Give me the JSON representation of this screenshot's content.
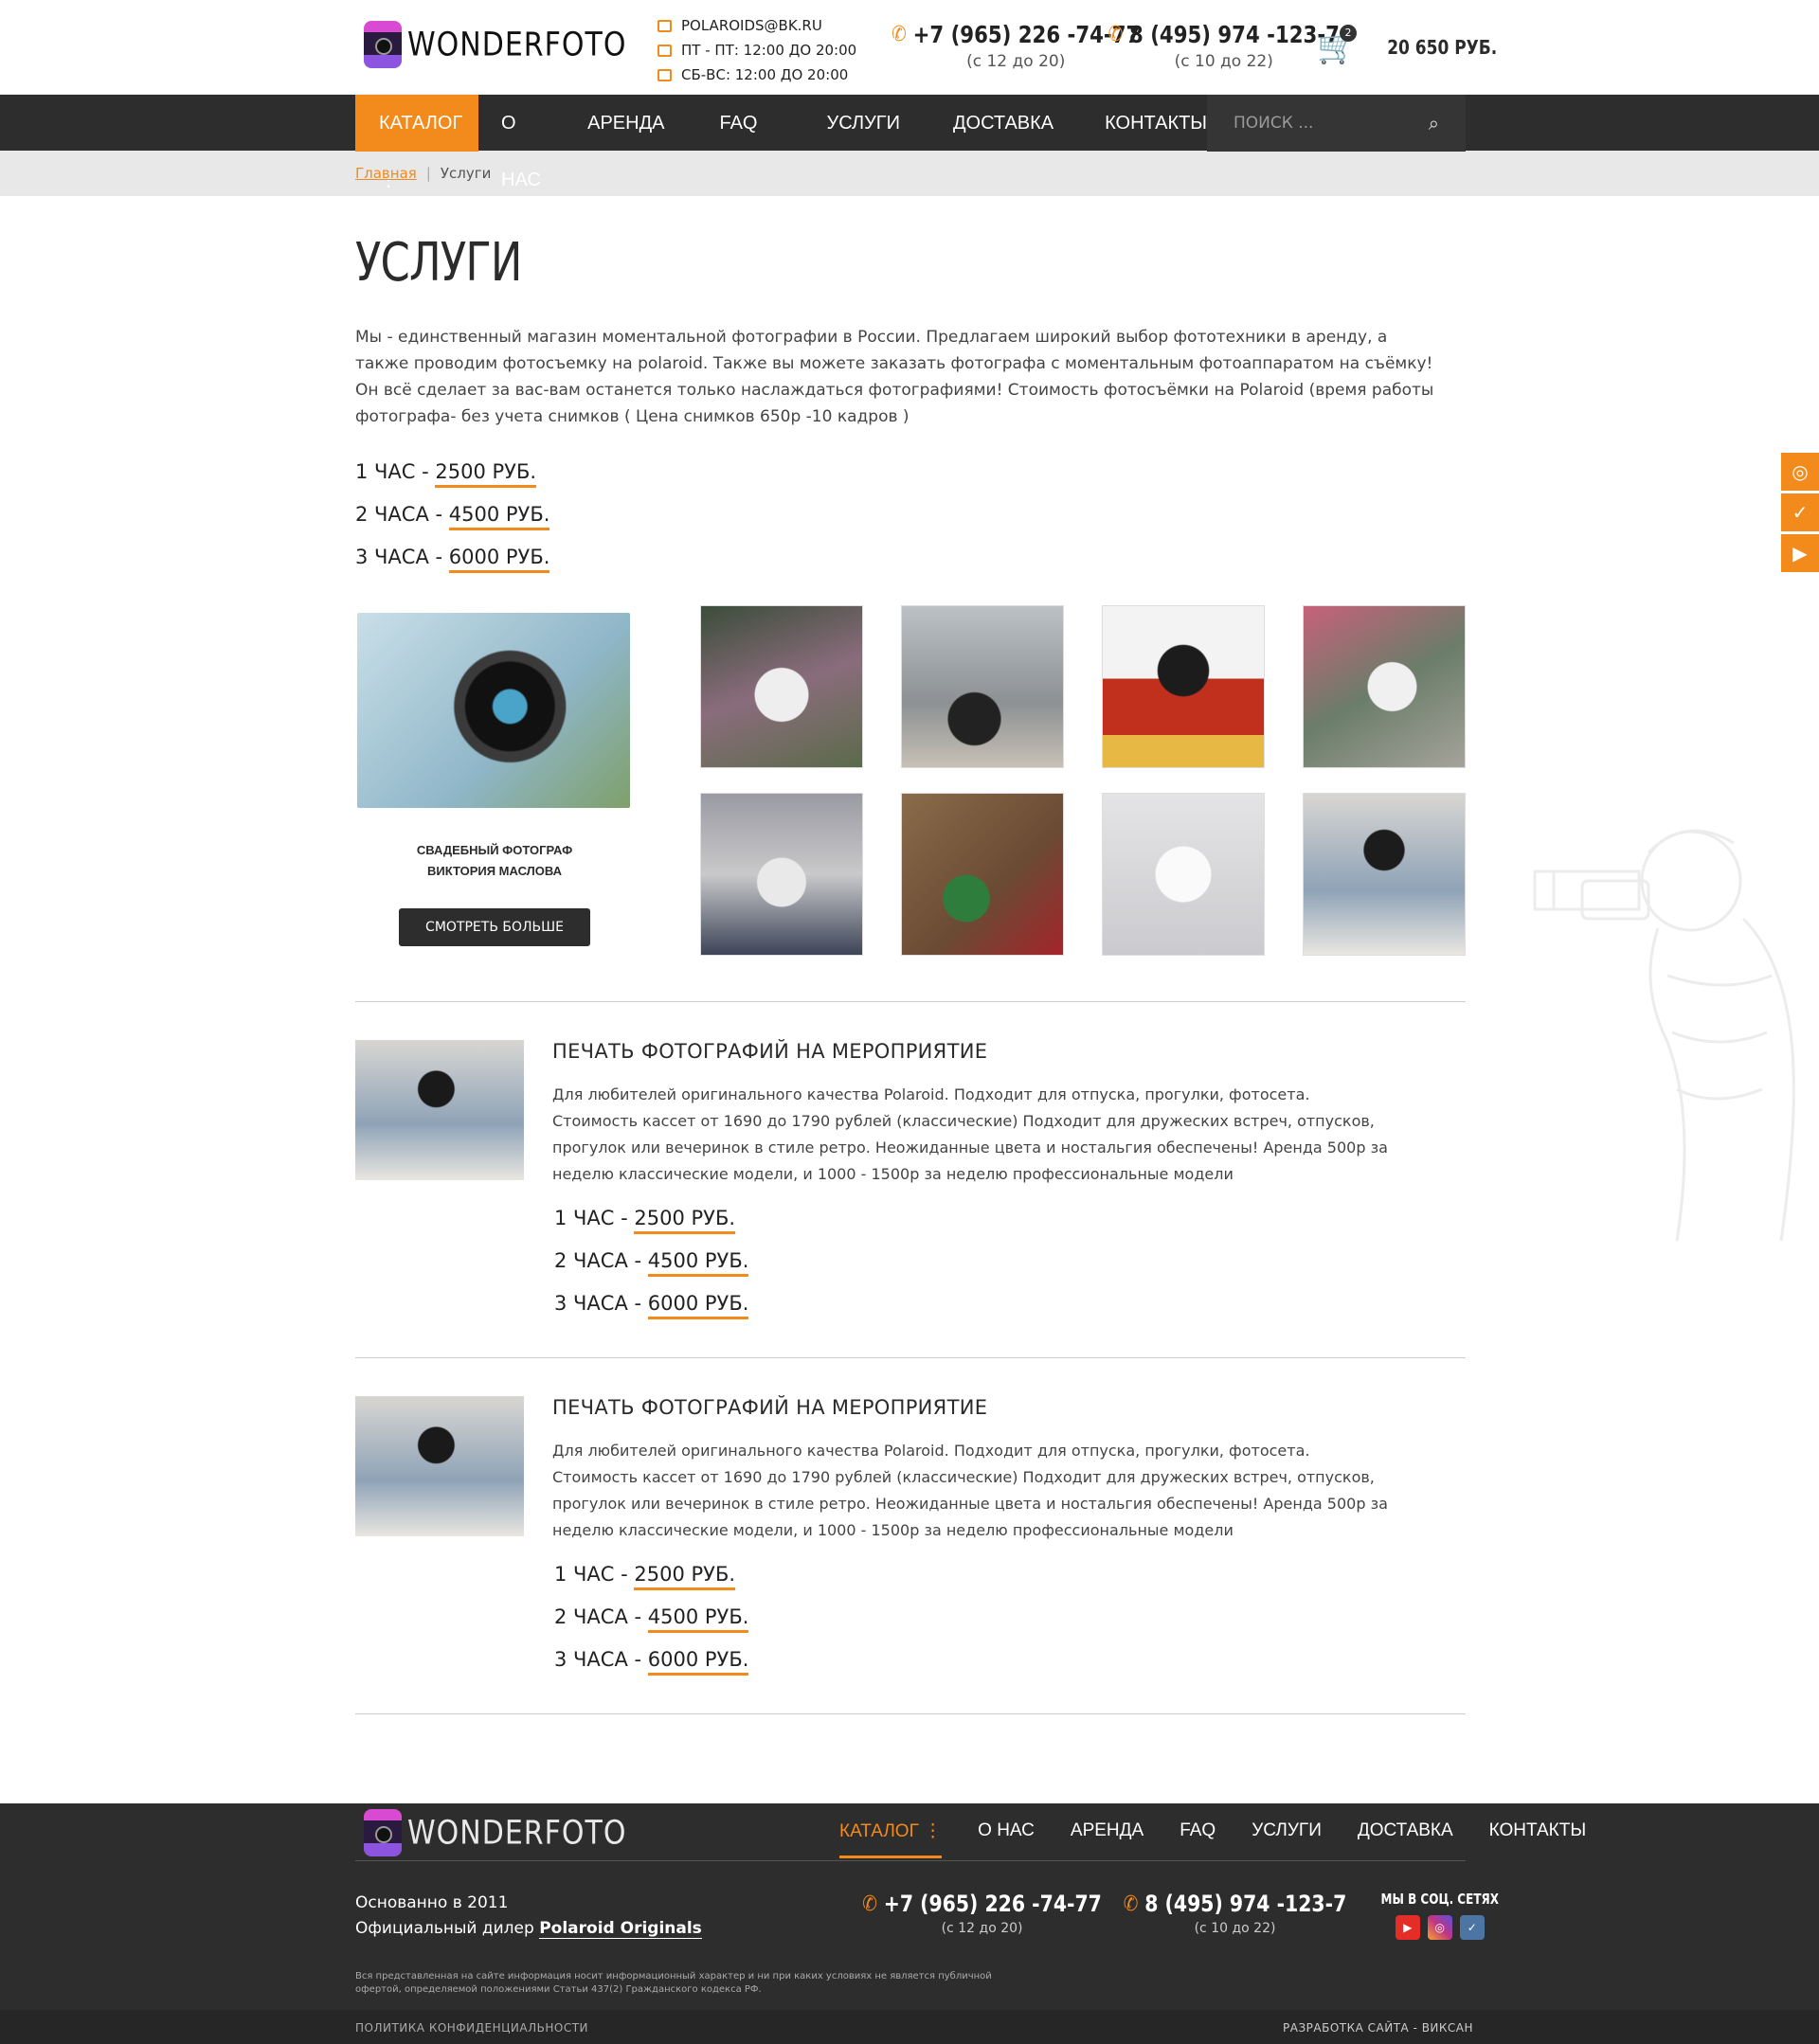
{
  "brand": {
    "logo": "WONDERFOTO"
  },
  "header": {
    "email": "POLAROIDS@BK.RU",
    "hours_weekdays": "ПТ - ПТ: 12:00 ДО 20:00",
    "hours_weekend": "СБ-ВС: 12:00 ДО 20:00",
    "phone1": "+7 (965) 226 -74-77",
    "phone1_hours": "(с 12 до 20)",
    "phone2": "8 (495) 974 -123-7",
    "phone2_hours": "(с 10 до 22)",
    "cart_count": "2",
    "cart_total": "20 650 РУБ."
  },
  "nav": {
    "catalog": "КАТАЛОГ",
    "items": [
      "О НАС",
      "АРЕНДА",
      "FAQ",
      "УСЛУГИ",
      "ДОСТАВКА",
      "КОНТАКТЫ"
    ],
    "search_placeholder": "ПОИСК ..."
  },
  "breadcrumb": {
    "home": "Главная",
    "current": "Услуги"
  },
  "page": {
    "title": "УСЛУГИ",
    "lead": "Мы - единственный магазин моментальной фотографии в России. Предлагаем широкий выбор фототехники в аренду, а также проводим фотосъемку на polaroid. Также вы можете заказать фотографа с моментальным фотоаппаратом на съёмку! Он всё сделает за вас-вам останется только наслаждаться фотографиями! Стоимость фотосъёмки на Polaroid    (время работы фотографа- без учета снимков ( Цена снимков 650р -10 кадров )",
    "prices": [
      {
        "label": "1 ЧАС - ",
        "value": "2500 РУБ."
      },
      {
        "label": "2 ЧАСА - ",
        "value": "4500 РУБ."
      },
      {
        "label": "3 ЧАСА - ",
        "value": "6000 РУБ."
      }
    ],
    "photographer": {
      "line1": "СВАДЕБНЫЙ ФОТОГРАФ",
      "line2": "ВИКТОРИЯ МАСЛОВА",
      "button": "СМОТРЕТЬ БОЛЬШЕ"
    }
  },
  "services": [
    {
      "title": "ПЕЧАТЬ ФОТОГРАФИЙ НА МЕРОПРИЯТИЕ",
      "desc1": "Для любителей оригинального качества Polaroid. Подходит для отпуска, прогулки, фотосета.",
      "desc2": "Стоимость кассет от 1690 до 1790 рублей (классические) Подходит для дружеских встреч, отпусков, прогулок или вечеринок в стиле ретро. Неожиданные цвета и ностальгия обеспечены! Аренда 500р за неделю классические модели, и 1000 - 1500р за неделю профессиональные модели",
      "prices": [
        {
          "label": "1 ЧАС - ",
          "value": "2500 РУБ."
        },
        {
          "label": "2 ЧАСА - ",
          "value": "4500 РУБ."
        },
        {
          "label": "3 ЧАСА - ",
          "value": "6000 РУБ."
        }
      ]
    },
    {
      "title": "ПЕЧАТЬ ФОТОГРАФИЙ НА МЕРОПРИЯТИЕ",
      "desc1": "Для любителей оригинального качества Polaroid. Подходит для отпуска, прогулки, фотосета.",
      "desc2": "Стоимость кассет от 1690 до 1790 рублей (классические) Подходит для дружеских встреч, отпусков, прогулок или вечеринок в стиле ретро. Неожиданные цвета и ностальгия обеспечены! Аренда 500р за неделю классические модели, и 1000 - 1500р за неделю профессиональные модели",
      "prices": [
        {
          "label": "1 ЧАС - ",
          "value": "2500 РУБ."
        },
        {
          "label": "2 ЧАСА - ",
          "value": "4500 РУБ."
        },
        {
          "label": "3 ЧАСА - ",
          "value": "6000 РУБ."
        }
      ]
    }
  ],
  "footer": {
    "nav": [
      "КАТАЛОГ",
      "О НАС",
      "АРЕНДА",
      "FAQ",
      "УСЛУГИ",
      "ДОСТАВКА",
      "КОНТАКТЫ"
    ],
    "founded": "Основанно в 2011",
    "dealer_prefix": "Официальный дилер ",
    "dealer": "Polaroid Originals",
    "phone1": "+7 (965) 226 -74-77",
    "phone1_hours": "(с 12 до 20)",
    "phone2": "8 (495) 974 -123-7",
    "phone2_hours": "(с 10 до 22)",
    "social_title": "МЫ В СОЦ. СЕТЯХ",
    "disclaimer": "Вся представленная на сайте информация носит информационный характер и ни при каких условиях не является публичной офертой, определяемой положениями Статьи 437(2) Гражданского кодекса РФ.",
    "privacy": "ПОЛИТИКА КОНФИДЕНЦИАЛЬНОСТИ",
    "dev": "РАЗРАБОТКА САЙТА - ВИКСАН"
  },
  "colors": {
    "accent": "#f28a1c",
    "dark": "#2d2d2d"
  }
}
